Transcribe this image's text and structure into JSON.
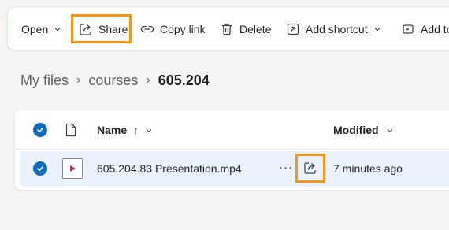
{
  "toolbar": {
    "open_label": "Open",
    "share_label": "Share",
    "copy_link_label": "Copy link",
    "delete_label": "Delete",
    "add_shortcut_label": "Add shortcut",
    "add_to_label": "Add to"
  },
  "breadcrumb": {
    "items": [
      "My files",
      "courses"
    ],
    "current": "605.204",
    "separator": "›"
  },
  "list": {
    "columns": {
      "name": "Name",
      "name_sort": "↑",
      "modified": "Modified"
    },
    "rows": [
      {
        "name": "605.204.83 Presentation.mp4",
        "modified": "7 minutes ago",
        "more": "···",
        "selected": true
      }
    ]
  },
  "colors": {
    "accent": "#0f6cbd",
    "highlight": "#f7941d",
    "selected_row": "#eaf2fb",
    "video_icon": "#c4314b"
  }
}
